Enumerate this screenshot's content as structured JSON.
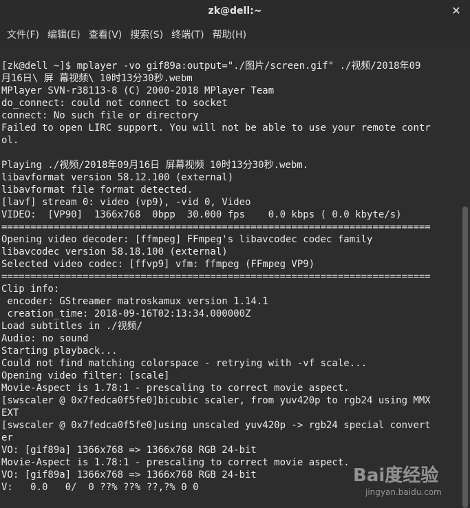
{
  "window": {
    "title": "zk@dell:~",
    "close_icon": "close-icon"
  },
  "menu": [
    "文件(F)",
    "编辑(E)",
    "查看(V)",
    "搜索(S)",
    "终端(T)",
    "帮助(H)"
  ],
  "terminal_lines": [
    "[zk@dell ~]$ mplayer -vo gif89a:output=\"./图片/screen.gif\" ./视频/2018年09",
    "月16日\\ 屏 幕视频\\ 10时13分30秒.webm",
    "MPlayer SVN-r38113-8 (C) 2000-2018 MPlayer Team",
    "do_connect: could not connect to socket",
    "connect: No such file or directory",
    "Failed to open LIRC support. You will not be able to use your remote contr",
    "ol.",
    "",
    "Playing ./视频/2018年09月16日 屏幕视频 10时13分30秒.webm.",
    "libavformat version 58.12.100 (external)",
    "libavformat file format detected.",
    "[lavf] stream 0: video (vp9), -vid 0, Video",
    "VIDEO:  [VP90]  1366x768  0bpp  30.000 fps    0.0 kbps ( 0.0 kbyte/s)",
    "==========================================================================",
    "Opening video decoder: [ffmpeg] FFmpeg's libavcodec codec family",
    "libavcodec version 58.18.100 (external)",
    "Selected video codec: [ffvp9] vfm: ffmpeg (FFmpeg VP9)",
    "==========================================================================",
    "Clip info:",
    " encoder: GStreamer matroskamux version 1.14.1",
    " creation_time: 2018-09-16T02:13:34.000000Z",
    "Load subtitles in ./视频/",
    "Audio: no sound",
    "Starting playback...",
    "Could not find matching colorspace - retrying with -vf scale...",
    "Opening video filter: [scale]",
    "Movie-Aspect is 1.78:1 - prescaling to correct movie aspect.",
    "[swscaler @ 0x7fedca0f5fe0]bicubic scaler, from yuv420p to rgb24 using MMX",
    "EXT",
    "[swscaler @ 0x7fedca0f5fe0]using unscaled yuv420p -> rgb24 special convert",
    "er",
    "VO: [gif89a] 1366x768 => 1366x768 RGB 24-bit",
    "Movie-Aspect is 1.78:1 - prescaling to correct movie aspect.",
    "VO: [gif89a] 1366x768 => 1366x768 RGB 24-bit",
    "V:   0.0   0/  0 ??% ??% ??,?% 0 0"
  ],
  "watermark": {
    "logo": "Bai度经验",
    "url": "jingyan.baidu.com"
  }
}
